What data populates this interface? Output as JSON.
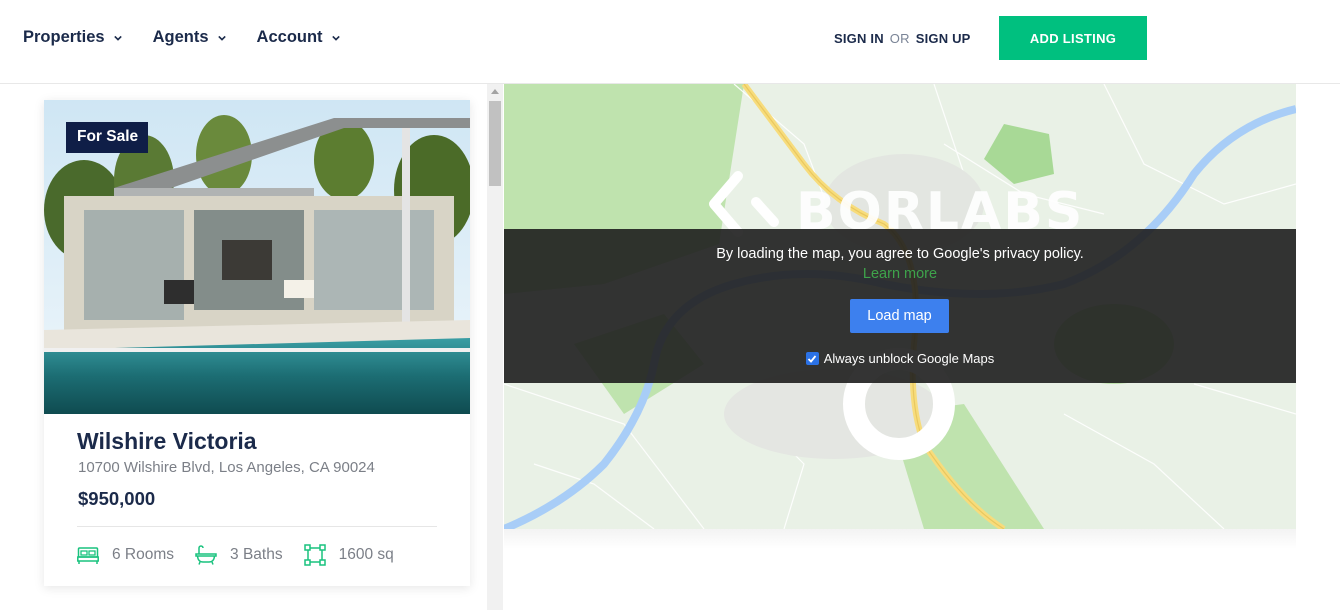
{
  "nav": {
    "items": [
      {
        "label": "Properties"
      },
      {
        "label": "Agents"
      },
      {
        "label": "Account"
      }
    ]
  },
  "auth": {
    "sign_in": "SIGN IN",
    "or": "OR",
    "sign_up": "SIGN UP"
  },
  "add_listing": "ADD LISTING",
  "listing": {
    "badge": "For Sale",
    "title": "Wilshire Victoria",
    "address": "10700 Wilshire Blvd, Los Angeles, CA 90024",
    "price": "$950,000",
    "features": {
      "rooms": "6 Rooms",
      "baths": "3 Baths",
      "area": "1600 sq"
    }
  },
  "map": {
    "watermark": "BORLABS",
    "consent_text": "By loading the map, you agree to Google's privacy policy.",
    "learn_more": "Learn more",
    "load_button": "Load map",
    "always_unblock": "Always unblock Google Maps",
    "always_unblock_checked": true
  },
  "colors": {
    "brand_navy": "#1b2a4a",
    "badge_navy": "#0f1e47",
    "accent_green": "#00c07f",
    "button_blue": "#3d80ee",
    "link_green": "#3ea34b"
  },
  "icons": [
    "chevron-down-icon",
    "bed-icon",
    "bathtub-icon",
    "area-icon"
  ]
}
